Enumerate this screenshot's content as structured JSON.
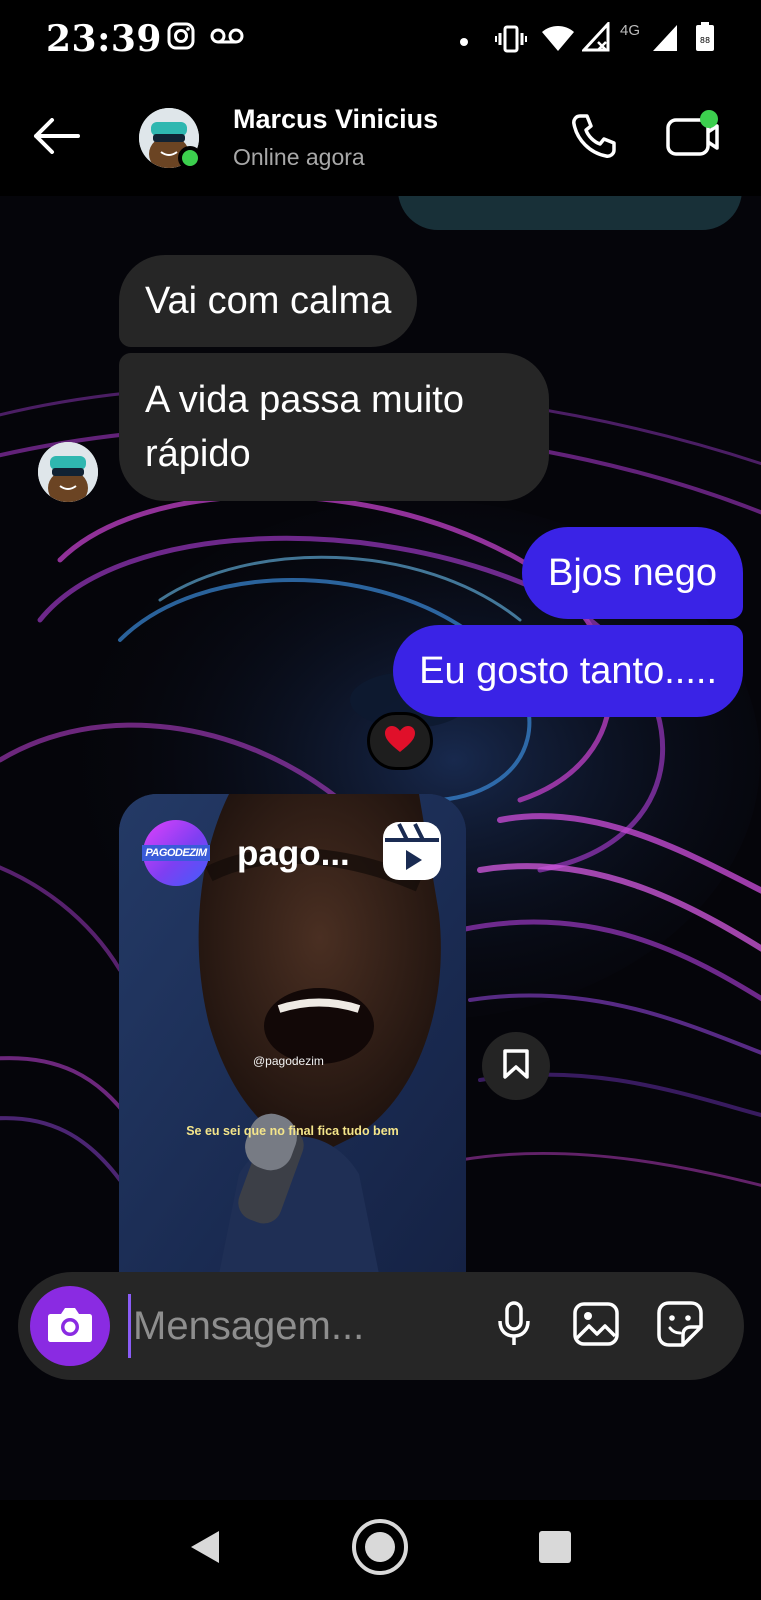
{
  "status_bar": {
    "time": "23:39",
    "network": "4G",
    "icons": [
      "instagram-icon",
      "voicemail-icon",
      "dot-icon",
      "vibrate-icon",
      "wifi-icon",
      "signal-no-data-icon",
      "signal-icon",
      "battery-icon"
    ]
  },
  "header": {
    "contact_name": "Marcus Vinicius",
    "contact_status": "Online agora",
    "online": true,
    "icons": [
      "back-arrow-icon",
      "phone-icon",
      "video-call-icon"
    ]
  },
  "messages": [
    {
      "direction": "in",
      "text": "Vai com calma"
    },
    {
      "direction": "in",
      "text": "A vida passa muito rápido"
    },
    {
      "direction": "out",
      "text": "Bjos nego"
    },
    {
      "direction": "out",
      "text": "Eu gosto tanto....."
    }
  ],
  "reaction": {
    "emoji": "heart",
    "color": "#e0102a"
  },
  "reel": {
    "logo_text": "PAGODEZIM",
    "author": "pago...",
    "handle": "@pagodezim",
    "caption": "Se eu sei que no final fica tudo bem",
    "icons": [
      "reels-icon",
      "bookmark-icon"
    ]
  },
  "composer": {
    "placeholder": "Mensagem...",
    "value": "",
    "icons": [
      "camera-icon",
      "microphone-icon",
      "gallery-icon",
      "sticker-icon"
    ]
  },
  "nav_bar": {
    "icons": [
      "nav-back-icon",
      "nav-home-icon",
      "nav-recents-icon"
    ]
  },
  "colors": {
    "outgoing_bubble": "#3a23e6",
    "incoming_bubble": "#262626",
    "online": "#3ccf4e",
    "camera_button": "#8a2be2"
  }
}
